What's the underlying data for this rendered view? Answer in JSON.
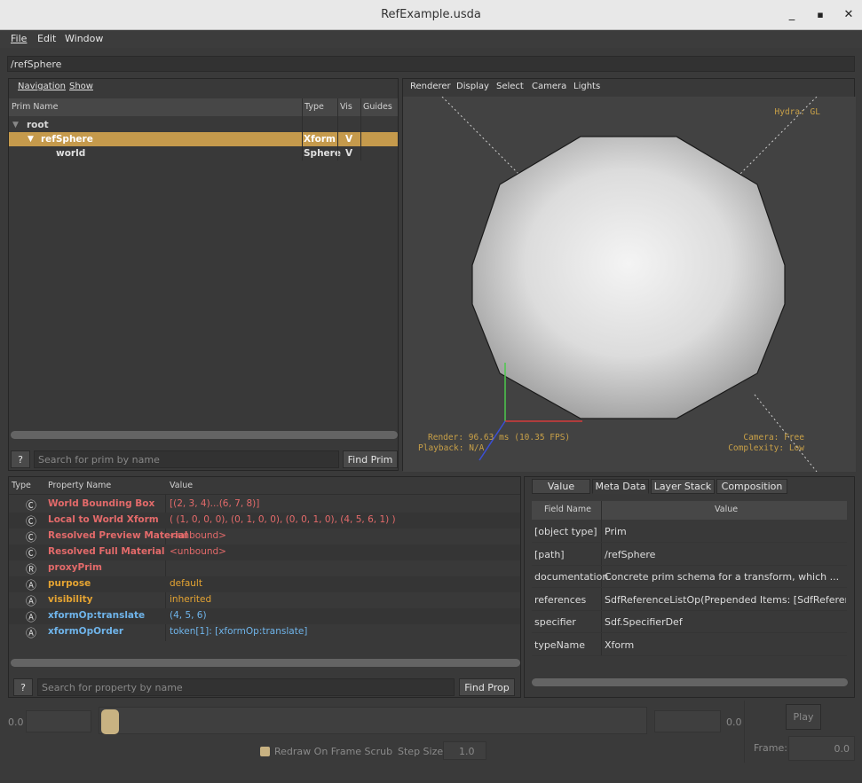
{
  "window": {
    "title": "RefExample.usda"
  },
  "menu": [
    "File",
    "Edit",
    "Window"
  ],
  "path_bar": "/refSphere",
  "tree": {
    "menu": [
      "Navigation",
      "Show"
    ],
    "columns": [
      "Prim Name",
      "Type",
      "Vis",
      "Guides"
    ],
    "rows": [
      {
        "name": "root",
        "type": "",
        "vis": ""
      },
      {
        "name": "refSphere",
        "type": "Xform",
        "vis": "V"
      },
      {
        "name": "world",
        "type": "Sphere",
        "vis": "V"
      }
    ],
    "help_label": "?",
    "search_placeholder": "Search for prim by name",
    "find_label": "Find Prim"
  },
  "viewport": {
    "menu": [
      "Renderer",
      "Display",
      "Select",
      "Camera",
      "Lights"
    ],
    "renderer": "Hydra: GL",
    "render_time": "Render: 96.63 ms (10.35 FPS)",
    "playback": "Playback: N/A",
    "camera": "Camera: Free",
    "complexity": "Complexity: Low",
    "colors": {
      "background": "#424242",
      "hud": "#c8a048",
      "x_axis": "#d43b3b",
      "y_axis": "#4cc94c",
      "z_axis": "#3b4fd4"
    }
  },
  "properties": {
    "columns": [
      "Type",
      "Property Name",
      "Value"
    ],
    "rows": [
      {
        "icon": "Ⓒ",
        "name": "World Bounding Box",
        "value": "[(2, 3, 4)...(6, 7, 8)]",
        "color": "#e36a6a"
      },
      {
        "icon": "Ⓒ",
        "name": "Local to World Xform",
        "value": "( (1, 0, 0, 0), (0, 1, 0, 0), (0, 0, 1, 0), (4, 5, 6, 1) )",
        "color": "#e36a6a"
      },
      {
        "icon": "Ⓒ",
        "name": "Resolved Preview Material",
        "value": "<unbound>",
        "color": "#e36a6a"
      },
      {
        "icon": "Ⓒ",
        "name": "Resolved Full Material",
        "value": "<unbound>",
        "color": "#e36a6a"
      },
      {
        "icon": "Ⓡ",
        "name": "proxyPrim",
        "value": "",
        "color": "#e36a6a"
      },
      {
        "icon": "Ⓐ",
        "name": "purpose",
        "value": "default",
        "color": "#e5a432"
      },
      {
        "icon": "Ⓐ",
        "name": "visibility",
        "value": "inherited",
        "color": "#e5a432"
      },
      {
        "icon": "Ⓐ",
        "name": "xformOp:translate",
        "value": "(4, 5, 6)",
        "color": "#6fb4ea"
      },
      {
        "icon": "Ⓐ",
        "name": "xformOpOrder",
        "value": "token[1]: [xformOp:translate]",
        "color": "#6fb4ea"
      }
    ],
    "help_label": "?",
    "search_placeholder": "Search for property by name",
    "find_label": "Find Prop"
  },
  "meta": {
    "tabs": [
      "Value",
      "Meta Data",
      "Layer Stack",
      "Composition"
    ],
    "columns": [
      "Field Name",
      "Value"
    ],
    "rows": [
      {
        "field": "[object type]",
        "value": "Prim"
      },
      {
        "field": "[path]",
        "value": "/refSphere"
      },
      {
        "field": "documentation",
        "value": "Concrete prim schema for a transform, which ..."
      },
      {
        "field": "references",
        "value": "SdfReferenceListOp(Prepended Items: [SdfReference(..."
      },
      {
        "field": "specifier",
        "value": "Sdf.SpecifierDef"
      },
      {
        "field": "typeName",
        "value": "Xform"
      }
    ]
  },
  "timeline": {
    "start_label": "0.0",
    "end_label": "0.0",
    "play_label": "Play",
    "redraw_label": "Redraw On Frame Scrub",
    "step_size_label": "Step Size",
    "step_size_value": "1.0",
    "frame_label": "Frame:",
    "frame_value": "0.0"
  },
  "accent_color": "#c8a048"
}
